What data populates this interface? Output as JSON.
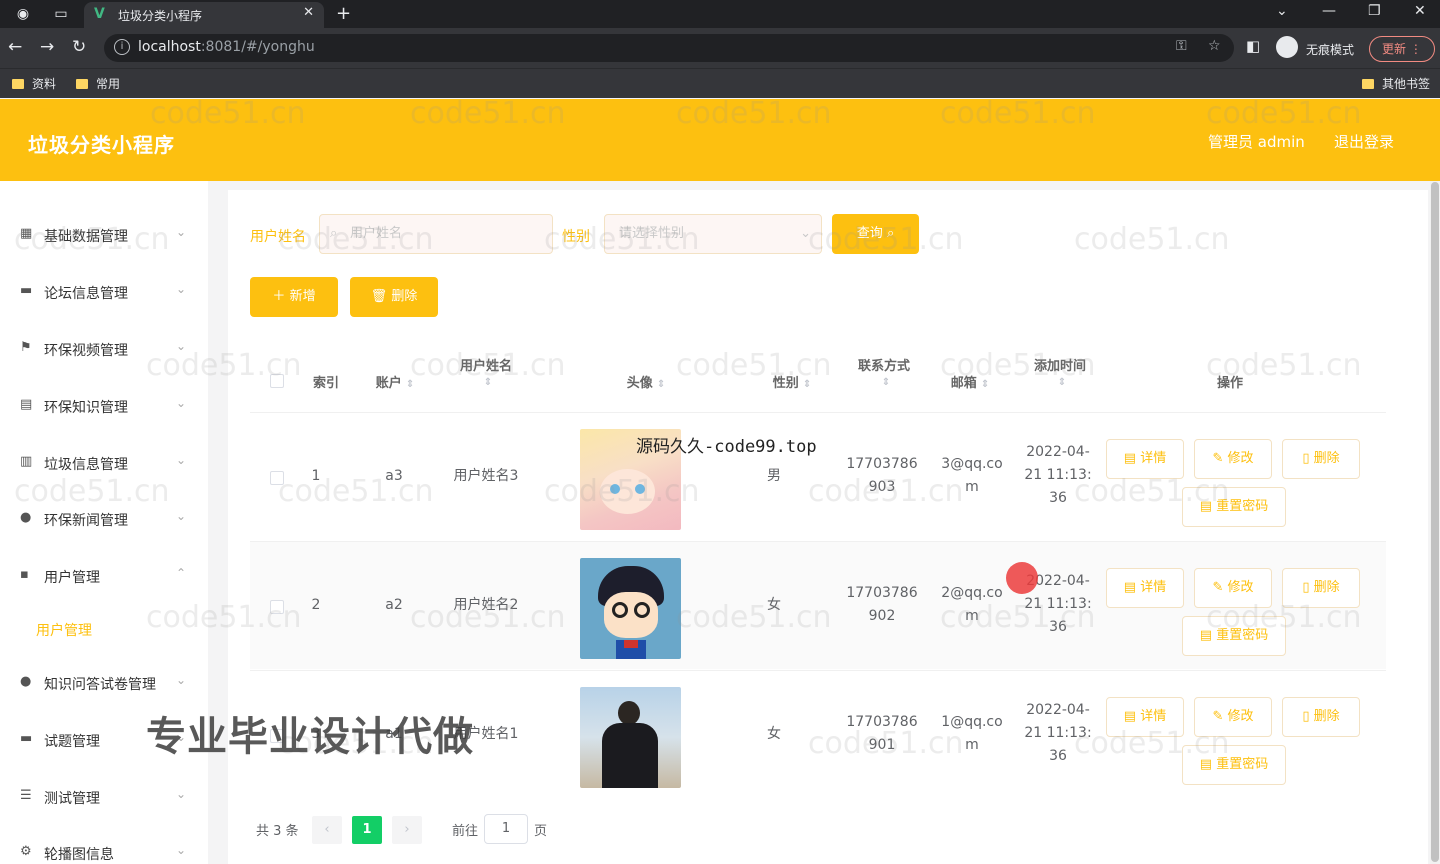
{
  "browser": {
    "tab_title": "垃圾分类小程序",
    "url_host": "localhost",
    "url_rest": ":8081/#/yonghu",
    "incognito_label": "无痕模式",
    "update_label": "更新",
    "bookmarks": [
      "资料",
      "常用"
    ],
    "other_bookmarks": "其他书签"
  },
  "header": {
    "title": "垃圾分类小程序",
    "user": "管理员 admin",
    "logout": "退出登录"
  },
  "sidebar": {
    "items": [
      {
        "label": "基础数据管理",
        "icon": "grid-icon"
      },
      {
        "label": "论坛信息管理",
        "icon": "monitor-icon"
      },
      {
        "label": "环保视频管理",
        "icon": "flag-icon"
      },
      {
        "label": "环保知识管理",
        "icon": "document-icon"
      },
      {
        "label": "垃圾信息管理",
        "icon": "bar-chart-icon"
      },
      {
        "label": "环保新闻管理",
        "icon": "bulb-icon"
      },
      {
        "label": "用户管理",
        "icon": "chat-icon"
      },
      {
        "label": "知识问答试卷管理",
        "icon": "user-icon"
      },
      {
        "label": "试题管理",
        "icon": "keyboard-icon"
      },
      {
        "label": "测试管理",
        "icon": "list-icon"
      },
      {
        "label": "轮播图信息",
        "icon": "settings-icon"
      }
    ],
    "sub_item": "用户管理"
  },
  "search": {
    "name_label": "用户姓名",
    "name_placeholder": "用户姓名",
    "gender_label": "性别",
    "gender_placeholder": "请选择性别",
    "query_button": "查询"
  },
  "toolbar": {
    "add_button": "新增",
    "delete_button": "删除"
  },
  "table": {
    "headers": {
      "index": "索引",
      "account": "账户",
      "name": "用户姓名",
      "avatar": "头像",
      "gender": "性别",
      "phone": "联系方式",
      "email": "邮箱",
      "created": "添加时间",
      "actions": "操作"
    },
    "rows": [
      {
        "index": "1",
        "account": "a3",
        "name": "用户姓名3",
        "gender": "男",
        "phone1": "17703786",
        "phone2": "903",
        "email1": "3@qq.co",
        "email2": "m",
        "date1": "2022-04-",
        "date2": "21 11:13:",
        "date3": "36",
        "avatar": "anime-girl-avatar"
      },
      {
        "index": "2",
        "account": "a2",
        "name": "用户姓名2",
        "gender": "女",
        "phone1": "17703786",
        "phone2": "902",
        "email1": "2@qq.co",
        "email2": "m",
        "date1": "2022-04-",
        "date2": "21 11:13:",
        "date3": "36",
        "avatar": "detective-boy-avatar"
      },
      {
        "index": "3",
        "account": "a1",
        "name": "用户姓名1",
        "gender": "女",
        "phone1": "17703786",
        "phone2": "901",
        "email1": "1@qq.co",
        "email2": "m",
        "date1": "2022-04-",
        "date2": "21 11:13:",
        "date3": "36",
        "avatar": "person-photo-avatar"
      }
    ],
    "actions": {
      "detail": "详情",
      "edit": "修改",
      "delete": "删除",
      "reset_password": "重置密码"
    }
  },
  "pagination": {
    "total": "共 3 条",
    "current_page": "1",
    "goto_label": "前往",
    "goto_value": "1",
    "page_suffix": "页"
  },
  "overlays": {
    "source_watermark": "源码久久-code99.top",
    "promo_watermark": "专业毕业设计代做",
    "site_watermark": "code51.cn"
  },
  "colors": {
    "brand": "#fdc010",
    "current_page": "#13ce66"
  }
}
